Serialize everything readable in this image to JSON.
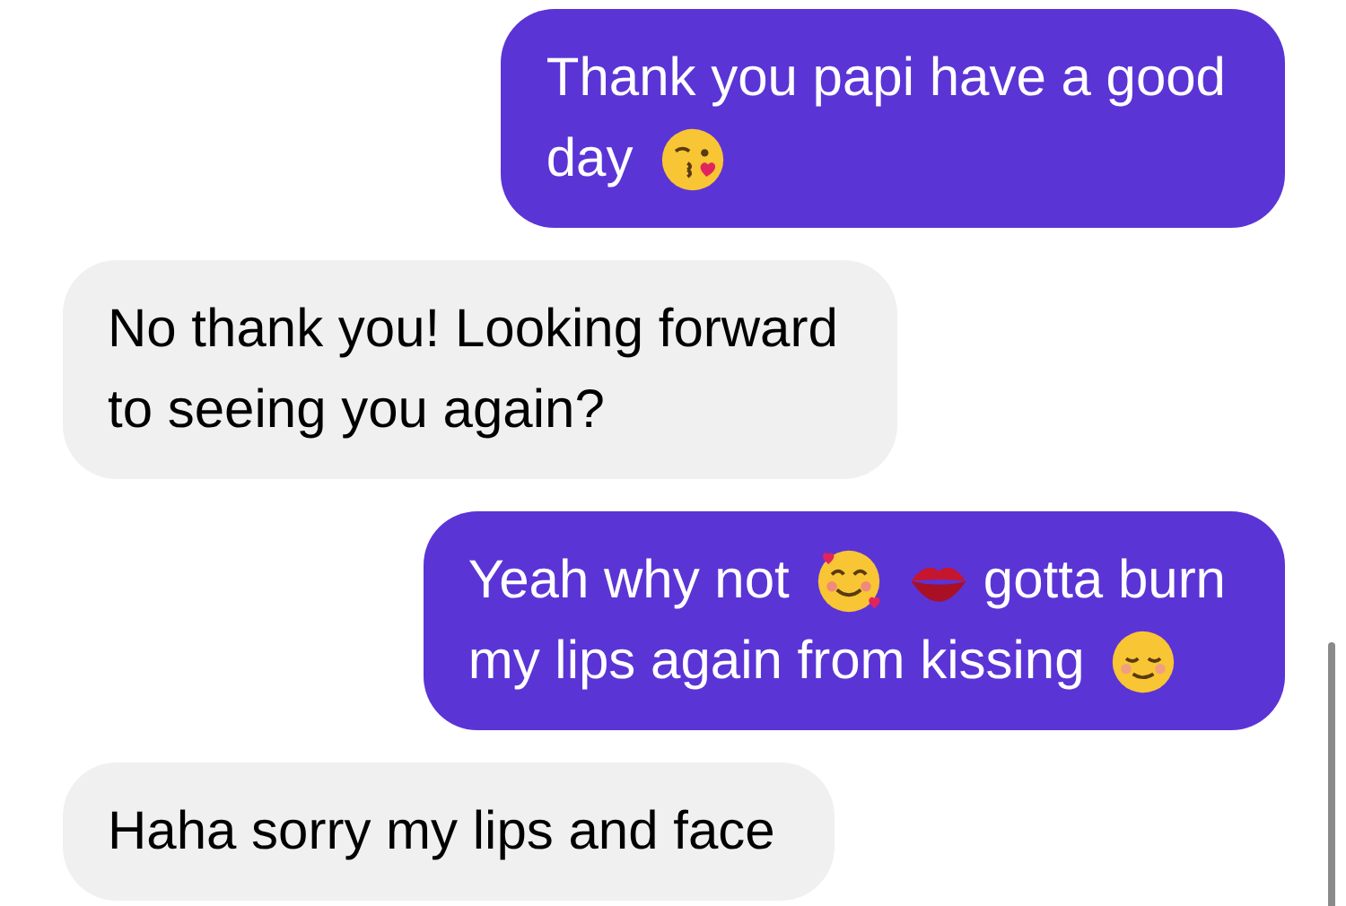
{
  "messages": [
    {
      "outgoing": true,
      "lines": [
        [
          {
            "kind": "text",
            "text": "Thank you papi have a good"
          }
        ],
        [
          {
            "kind": "text",
            "text": "day"
          },
          {
            "kind": "kiss"
          }
        ]
      ]
    },
    {
      "outgoing": false,
      "lines": [
        [
          {
            "kind": "text",
            "text": "No thank you! Looking forward"
          }
        ],
        [
          {
            "kind": "text",
            "text": "to seeing you again?"
          }
        ]
      ]
    },
    {
      "outgoing": true,
      "lines": [
        [
          {
            "kind": "text",
            "text": "Yeah why not"
          },
          {
            "kind": "hearts"
          },
          {
            "kind": "lips"
          },
          {
            "kind": "text",
            "text": "gotta burn"
          }
        ],
        [
          {
            "kind": "text",
            "text": "my lips again from kissing"
          },
          {
            "kind": "relieved"
          }
        ]
      ]
    },
    {
      "outgoing": false,
      "lines": [
        [
          {
            "kind": "text",
            "text": "Haha sorry my lips and face"
          }
        ]
      ]
    }
  ]
}
